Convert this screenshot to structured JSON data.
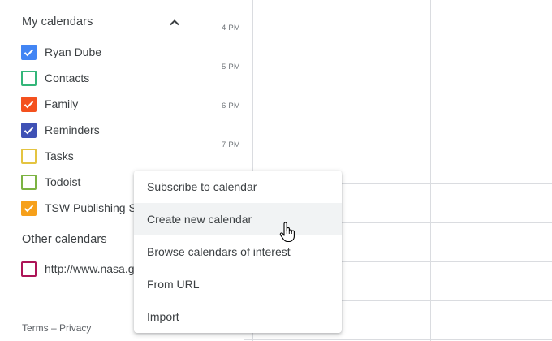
{
  "sidebar": {
    "my_calendars": {
      "title": "My calendars",
      "collapse_icon": "chevron-up-icon",
      "items": [
        {
          "label": "Ryan Dube",
          "checked": true,
          "color": "#4285f4"
        },
        {
          "label": "Contacts",
          "checked": false,
          "color": "#33b679"
        },
        {
          "label": "Family",
          "checked": true,
          "color": "#f4511e"
        },
        {
          "label": "Reminders",
          "checked": true,
          "color": "#3f51b5"
        },
        {
          "label": "Tasks",
          "checked": false,
          "color": "#e4c441"
        },
        {
          "label": "Todoist",
          "checked": false,
          "color": "#7cb342"
        },
        {
          "label": "TSW Publishing S",
          "checked": true,
          "color": "#f6a01a"
        }
      ]
    },
    "other_calendars": {
      "title": "Other calendars",
      "items": [
        {
          "label": "http://www.nasa.g",
          "checked": false,
          "color": "#ad1457"
        }
      ]
    },
    "footer": {
      "terms": "Terms",
      "separator": "–",
      "privacy": "Privacy"
    }
  },
  "grid": {
    "times": [
      "4 PM",
      "5 PM",
      "6 PM",
      "7 PM"
    ]
  },
  "context_menu": {
    "items": [
      {
        "label": "Subscribe to calendar"
      },
      {
        "label": "Create new calendar",
        "hovered": true
      },
      {
        "label": "Browse calendars of interest"
      },
      {
        "label": "From URL"
      },
      {
        "label": "Import"
      }
    ]
  }
}
